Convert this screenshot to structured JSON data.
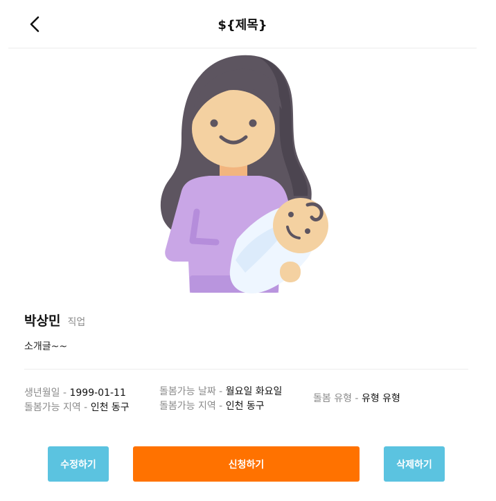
{
  "header": {
    "title": "${제목}",
    "back_icon": "chevron-left-icon"
  },
  "profile": {
    "illustration": "mother-holding-baby-illustration",
    "name": "박상민",
    "job": "직업",
    "intro": "소개글~~"
  },
  "info": {
    "birth_label": "생년월일",
    "birth_value": "1999-01-11",
    "region1_label": "돌봄가능 지역",
    "region1_value": "인천 동구",
    "days_label": "돌봄가능 날짜",
    "days_value": "월요일 화요일",
    "region2_label": "돌봄가능 지역",
    "region2_value": "인천 동구",
    "type_label": "돌봄 유형",
    "type_value": "유형 유형",
    "separator": " - "
  },
  "actions": {
    "edit": "수정하기",
    "apply": "신청하기",
    "delete": "삭제하기"
  },
  "colors": {
    "accent_orange": "#ff7200",
    "accent_blue": "#5bc3e0"
  }
}
